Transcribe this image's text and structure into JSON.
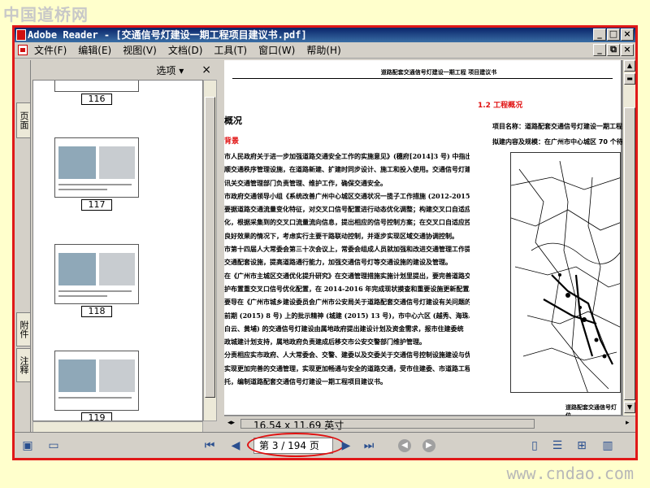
{
  "watermark": {
    "top": "中国道桥网",
    "bottom": "www.cndao.com"
  },
  "window": {
    "title": "Adobe Reader - [交通信号灯建设一期工程项目建议书.pdf]",
    "controls": [
      "_",
      "□",
      "×"
    ]
  },
  "menu": {
    "items": [
      "文件(F)",
      "编辑(E)",
      "视图(V)",
      "文档(D)",
      "工具(T)",
      "窗口(W)",
      "帮助(H)"
    ]
  },
  "nav_panel": {
    "tabs": [
      "页面",
      "附件",
      "注释"
    ],
    "options_label": "选项 ▾",
    "close_label": "×",
    "thumbnails": [
      "116",
      "117",
      "118",
      "119"
    ]
  },
  "document": {
    "header": "道路配套交通信号灯建设一期工程    项目建议书",
    "section_heading": "1.2 工程概况",
    "overview_heading": "概况",
    "background_heading": "背景",
    "project_name": "项目名称：道路配套交通信号灯建设一期工程",
    "scope": "拟建内容及规模：在广州市中心城区 70 个待",
    "body_lines": [
      "市人民政府关于进一步加强道路交通安全工作的实施意见》(穗府[2014]3 号) 中指出,",
      "顺交通秩序管理设施，在道路新建、扩建时同步设计、施工和投入使用。交通信号灯建",
      "讯关交通管理部门负责管理、维护工作，确保交通安全。",
      "市政府交通领导小组《系统改善广州中心城区交通状况一揽子工作措施 (2012-2015)》",
      "要据道路交通流量变化特征，对交叉口信号配置进行动态优化调整；构建交叉口自适应",
      "化，根据采集到的交叉口流量流向信息，提出相应的信号控制方案；在交叉口自适应控",
      "良好效果的情况下，考虑实行主要干路联动控制，并逐步实现区域交通协调控制。",
      "市第十四届人大常委会第三十次会议上，常委会组成人员就加强和改进交通管理工作提",
      "交通配套设施，提高道路通行能力，加强交通信号灯等交通设施的建设及管理。",
      "在《广州市主城区交通优化提升研究》在交通管理措施实施计划里提出，要完善道路交",
      "护布置重交叉口信号优化配置，在 2014-2016 年完成现状摸查和重要设施更新配置。",
      "要导在《广州市城乡建设委员会广州市公安局关于道路配套交通信号灯建设有关问题的",
      "前期 (2015) 8 号) 上的批示精神 (城建 (2015) 13 号)，市中心六区 (越秀、海珠、",
      "白云、黄埔) 的交通信号灯建设由属地政府提出建设计划及资金需求，报市住建委统",
      "政城建计划支持，属地政府负责建成后移交市公安交警部门维护管理。",
      "分责相应实市政府、人大常委会、交警、建委以及交委关于交通信号控制设施建设与优",
      "实现更加完善的交通管理，实现更加畅通与安全的道路交通，受市住建委、市道路工程",
      "托，编制道路配套交通信号灯建设一期工程项目建议书。"
    ],
    "map_caption": "道路配套交通信号灯位"
  },
  "page_size": "16.54 x 11.69 英寸",
  "status": {
    "page_indicator": "第 3 / 194 页"
  }
}
